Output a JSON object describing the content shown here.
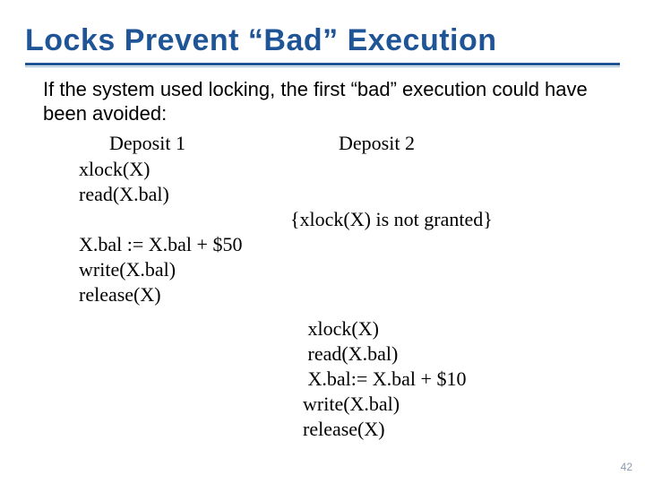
{
  "title": "Locks Prevent “Bad” Execution",
  "intro": "If the system used locking, the first “bad” execution could have been avoided:",
  "deposit1_label": "Deposit 1",
  "deposit2_label": "Deposit 2",
  "left_block1": "xlock(X)\nread(X.bal)",
  "right_note": "{xlock(X) is not granted}",
  "left_block2": "X.bal := X.bal + $50\nwrite(X.bal)\nrelease(X)",
  "right_block": " xlock(X)\n read(X.bal)\n X.bal:= X.bal + $10\nwrite(X.bal)\nrelease(X)",
  "page_number": "42"
}
